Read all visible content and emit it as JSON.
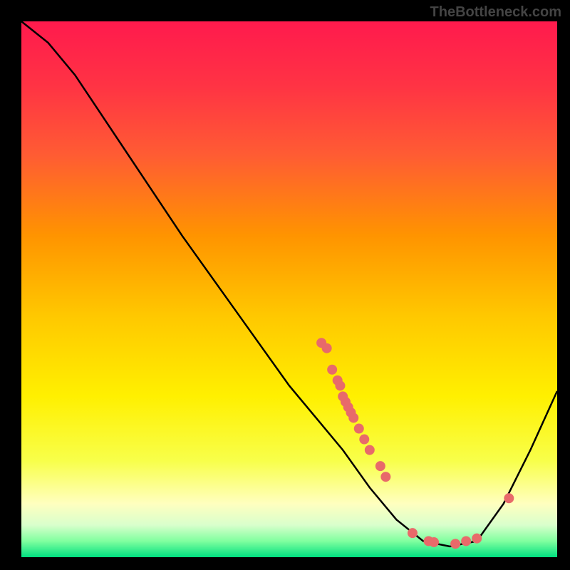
{
  "watermark": "TheBottleneck.com",
  "chart_data": {
    "type": "line",
    "title": "",
    "xlabel": "",
    "ylabel": "",
    "xlim": [
      0,
      100
    ],
    "ylim": [
      0,
      100
    ],
    "curve": [
      {
        "x": 0,
        "y": 100
      },
      {
        "x": 5,
        "y": 96
      },
      {
        "x": 10,
        "y": 90
      },
      {
        "x": 20,
        "y": 75
      },
      {
        "x": 30,
        "y": 60
      },
      {
        "x": 40,
        "y": 46
      },
      {
        "x": 50,
        "y": 32
      },
      {
        "x": 55,
        "y": 26
      },
      {
        "x": 60,
        "y": 20
      },
      {
        "x": 65,
        "y": 13
      },
      {
        "x": 70,
        "y": 7
      },
      {
        "x": 75,
        "y": 3
      },
      {
        "x": 80,
        "y": 2
      },
      {
        "x": 85,
        "y": 3
      },
      {
        "x": 90,
        "y": 10
      },
      {
        "x": 95,
        "y": 20
      },
      {
        "x": 100,
        "y": 31
      }
    ],
    "markers": [
      {
        "x": 56,
        "y": 40
      },
      {
        "x": 57,
        "y": 39
      },
      {
        "x": 58,
        "y": 35
      },
      {
        "x": 59,
        "y": 33
      },
      {
        "x": 59.5,
        "y": 32
      },
      {
        "x": 60,
        "y": 30
      },
      {
        "x": 60.5,
        "y": 29
      },
      {
        "x": 61,
        "y": 28
      },
      {
        "x": 61.5,
        "y": 27
      },
      {
        "x": 62,
        "y": 26
      },
      {
        "x": 63,
        "y": 24
      },
      {
        "x": 64,
        "y": 22
      },
      {
        "x": 65,
        "y": 20
      },
      {
        "x": 67,
        "y": 17
      },
      {
        "x": 68,
        "y": 15
      },
      {
        "x": 73,
        "y": 4.5
      },
      {
        "x": 76,
        "y": 3
      },
      {
        "x": 77,
        "y": 2.8
      },
      {
        "x": 81,
        "y": 2.5
      },
      {
        "x": 83,
        "y": 3
      },
      {
        "x": 85,
        "y": 3.5
      },
      {
        "x": 91,
        "y": 11
      }
    ],
    "gradient_stops": [
      {
        "offset": 0.0,
        "color": "#ff1a4d"
      },
      {
        "offset": 0.12,
        "color": "#ff3344"
      },
      {
        "offset": 0.25,
        "color": "#ff5c33"
      },
      {
        "offset": 0.4,
        "color": "#ff9400"
      },
      {
        "offset": 0.55,
        "color": "#ffc800"
      },
      {
        "offset": 0.7,
        "color": "#fff000"
      },
      {
        "offset": 0.82,
        "color": "#f8ff4a"
      },
      {
        "offset": 0.9,
        "color": "#ffffbf"
      },
      {
        "offset": 0.94,
        "color": "#d9ffcc"
      },
      {
        "offset": 0.97,
        "color": "#80ff9f"
      },
      {
        "offset": 1.0,
        "color": "#00e080"
      }
    ],
    "marker_color": "#e86a6a",
    "curve_color": "#000000"
  }
}
